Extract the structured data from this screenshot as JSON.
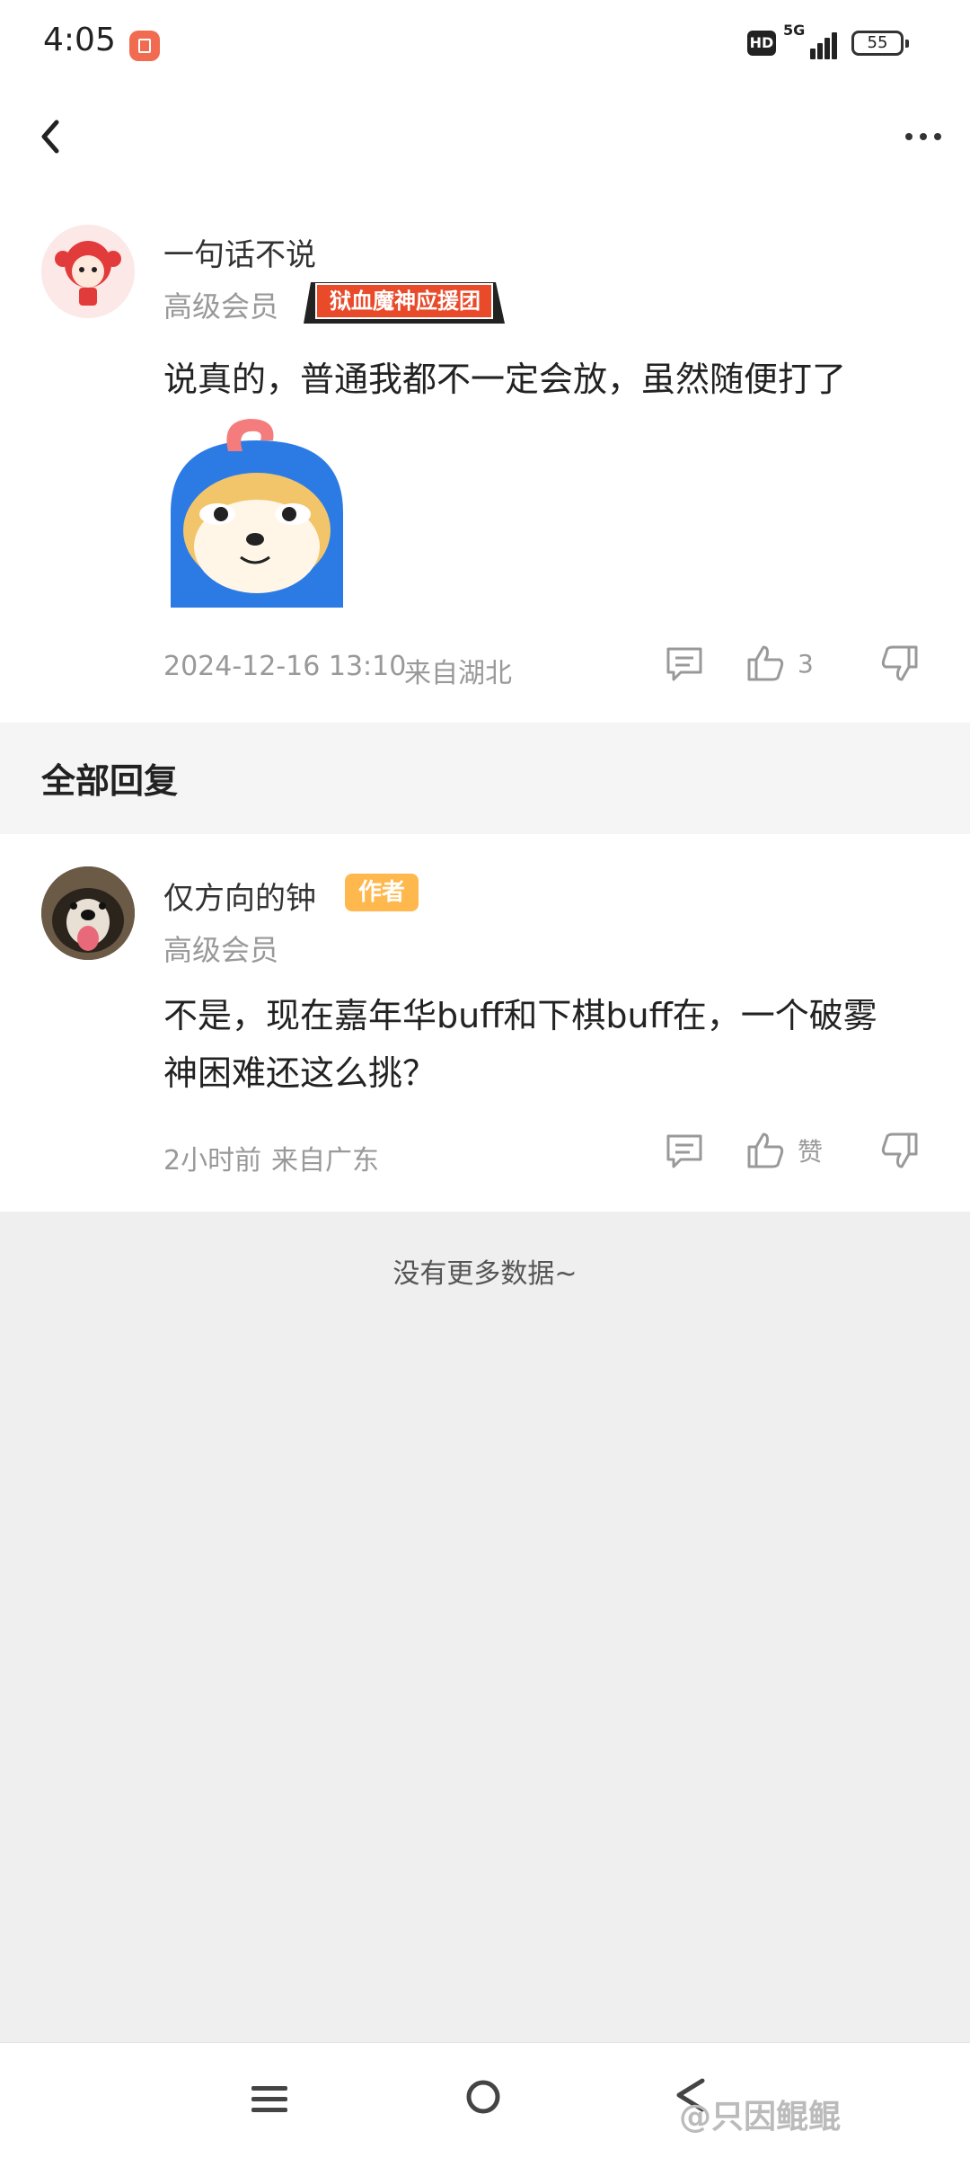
{
  "status_bar": {
    "time": "4:05",
    "network": "5G",
    "hd": "HD",
    "battery": "55",
    "notification_icon": "app-notification-icon"
  },
  "navbar": {
    "back_icon": "chevron-left-icon",
    "more_icon": "more-horizontal-icon"
  },
  "post": {
    "username": "一句话不说",
    "level": "高级会员",
    "fan_badge": "狱血魔神应援团",
    "content": "说真的，普通我都不一定会放，虽然随便打了",
    "timestamp": "2024-12-16 13:10",
    "location": "来自湖北",
    "like_count": "3",
    "icons": {
      "comment": "comment-icon",
      "like": "thumbs-up-icon",
      "dislike": "thumbs-down-icon"
    }
  },
  "section": {
    "title": "全部回复"
  },
  "reply": {
    "username": "仅方向的钟",
    "author_badge": "作者",
    "level": "高级会员",
    "content_line1": "不是，现在嘉年华buff和下棋buff在，一个破雾",
    "content_line2": "神困难还这么挑？",
    "time": "2小时前",
    "location": "来自广东",
    "like_label": "赞"
  },
  "footer": {
    "no_more": "没有更多数据~"
  },
  "bottom_nav": {
    "menu_icon": "menu-icon",
    "home_icon": "home-circle-icon",
    "back_icon": "back-icon"
  },
  "watermark": "@只因鲲鲲",
  "colors": {
    "accent_badge": "#ffb84d",
    "fan_badge": "#e84a2a",
    "secondary_text": "#999999"
  }
}
